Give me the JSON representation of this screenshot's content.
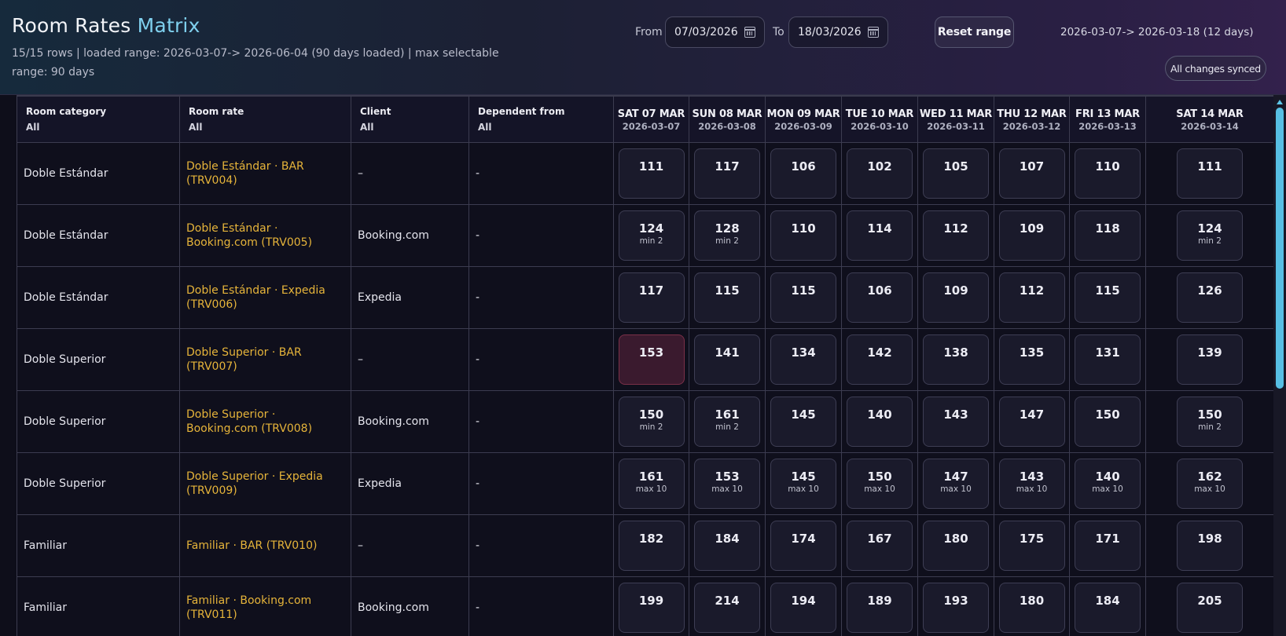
{
  "header": {
    "title_part1": "Room Rates",
    "title_part2": "Matrix",
    "subtitle": "15/15 rows | loaded range: 2026-03-07-> 2026-06-04 (90 days loaded) | max selectable range: 90 days",
    "from_label": "From",
    "from_value": "07/03/2026",
    "to_label": "To",
    "to_value": "18/03/2026",
    "reset_label": "Reset range",
    "range_text": "2026-03-07-> 2026-03-18 (12 days)",
    "sync_status": "All changes synced"
  },
  "columns": [
    {
      "name": "Room category",
      "filter": "All"
    },
    {
      "name": "Room rate",
      "filter": "All"
    },
    {
      "name": "Client",
      "filter": "All"
    },
    {
      "name": "Dependent from",
      "filter": "All"
    }
  ],
  "dates": [
    {
      "label": "SAT 07 MAR",
      "date": "2026-03-07"
    },
    {
      "label": "SUN 08 MAR",
      "date": "2026-03-08"
    },
    {
      "label": "MON 09 MAR",
      "date": "2026-03-09"
    },
    {
      "label": "TUE 10 MAR",
      "date": "2026-03-10"
    },
    {
      "label": "WED 11 MAR",
      "date": "2026-03-11"
    },
    {
      "label": "THU 12 MAR",
      "date": "2026-03-12"
    },
    {
      "label": "FRI 13 MAR",
      "date": "2026-03-13"
    },
    {
      "label": "SAT 14 MAR",
      "date": "2026-03-14"
    }
  ],
  "rows": [
    {
      "category": "Doble Estándar",
      "rate": "Doble Estándar · BAR (TRV004)",
      "client": "–",
      "dependent": "-",
      "cells": [
        {
          "v": "111"
        },
        {
          "v": "117"
        },
        {
          "v": "106"
        },
        {
          "v": "102"
        },
        {
          "v": "105"
        },
        {
          "v": "107"
        },
        {
          "v": "110"
        },
        {
          "v": "111"
        }
      ]
    },
    {
      "category": "Doble Estándar",
      "rate": "Doble Estándar · Booking.com (TRV005)",
      "client": "Booking.com",
      "dependent": "-",
      "cells": [
        {
          "v": "124",
          "n": "min 2"
        },
        {
          "v": "128",
          "n": "min 2"
        },
        {
          "v": "110"
        },
        {
          "v": "114"
        },
        {
          "v": "112"
        },
        {
          "v": "109"
        },
        {
          "v": "118"
        },
        {
          "v": "124",
          "n": "min 2"
        }
      ]
    },
    {
      "category": "Doble Estándar",
      "rate": "Doble Estándar · Expedia (TRV006)",
      "client": "Expedia",
      "dependent": "-",
      "cells": [
        {
          "v": "117"
        },
        {
          "v": "115"
        },
        {
          "v": "115"
        },
        {
          "v": "106"
        },
        {
          "v": "109"
        },
        {
          "v": "112"
        },
        {
          "v": "115"
        },
        {
          "v": "126"
        }
      ]
    },
    {
      "category": "Doble Superior",
      "rate": "Doble Superior · BAR (TRV007)",
      "client": "–",
      "dependent": "-",
      "cells": [
        {
          "v": "153",
          "hl": true
        },
        {
          "v": "141"
        },
        {
          "v": "134"
        },
        {
          "v": "142"
        },
        {
          "v": "138"
        },
        {
          "v": "135"
        },
        {
          "v": "131"
        },
        {
          "v": "139"
        }
      ]
    },
    {
      "category": "Doble Superior",
      "rate": "Doble Superior · Booking.com (TRV008)",
      "client": "Booking.com",
      "dependent": "-",
      "cells": [
        {
          "v": "150",
          "n": "min 2"
        },
        {
          "v": "161",
          "n": "min 2"
        },
        {
          "v": "145"
        },
        {
          "v": "140"
        },
        {
          "v": "143"
        },
        {
          "v": "147"
        },
        {
          "v": "150"
        },
        {
          "v": "150",
          "n": "min 2"
        }
      ]
    },
    {
      "category": "Doble Superior",
      "rate": "Doble Superior · Expedia (TRV009)",
      "client": "Expedia",
      "dependent": "-",
      "cells": [
        {
          "v": "161",
          "n": "max 10"
        },
        {
          "v": "153",
          "n": "max 10"
        },
        {
          "v": "145",
          "n": "max 10"
        },
        {
          "v": "150",
          "n": "max 10"
        },
        {
          "v": "147",
          "n": "max 10"
        },
        {
          "v": "143",
          "n": "max 10"
        },
        {
          "v": "140",
          "n": "max 10"
        },
        {
          "v": "162",
          "n": "max 10"
        }
      ]
    },
    {
      "category": "Familiar",
      "rate": "Familiar · BAR (TRV010)",
      "client": "–",
      "dependent": "-",
      "cells": [
        {
          "v": "182"
        },
        {
          "v": "184"
        },
        {
          "v": "174"
        },
        {
          "v": "167"
        },
        {
          "v": "180"
        },
        {
          "v": "175"
        },
        {
          "v": "171"
        },
        {
          "v": "198"
        }
      ]
    },
    {
      "category": "Familiar",
      "rate": "Familiar · Booking.com (TRV011)",
      "client": "Booking.com",
      "dependent": "-",
      "cells": [
        {
          "v": "199"
        },
        {
          "v": "214"
        },
        {
          "v": "194"
        },
        {
          "v": "189"
        },
        {
          "v": "193"
        },
        {
          "v": "180"
        },
        {
          "v": "184"
        },
        {
          "v": "205"
        }
      ]
    }
  ]
}
